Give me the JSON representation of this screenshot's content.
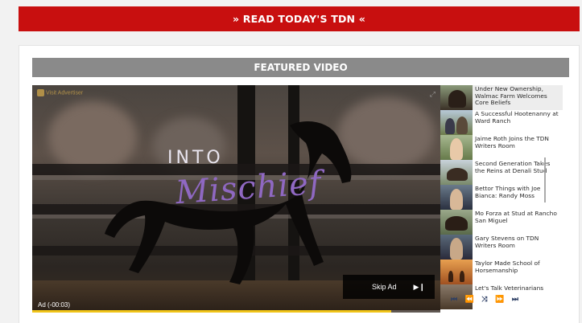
{
  "banner": {
    "label": "» READ TODAY'S TDN «"
  },
  "section": {
    "title": "FEATURED VIDEO"
  },
  "player": {
    "advertiser_link": "Visit Advertiser",
    "overlay_line1": "INTO",
    "overlay_line2": "Mischief",
    "ad_timer": "Ad (-00:03)",
    "skip_label": "Skip Ad",
    "progress": 0.88
  },
  "playlist": {
    "items": [
      {
        "title": "Under New Ownership, Walmac Farm Welcomes Core Beliefs",
        "active": true
      },
      {
        "title": "A Successful Hootenanny at Ward Ranch"
      },
      {
        "title": "Jaime Roth Joins the TDN Writers Room"
      },
      {
        "title": "Second Generation Takes the Reins at Denali Stud"
      },
      {
        "title": "Bettor Things with Joe Bianca: Randy Moss"
      },
      {
        "title": "Mo Forza at Stud at Rancho San Miguel"
      },
      {
        "title": "Gary Stevens on TDN Writers Room"
      },
      {
        "title": "Taylor Made School of Horsemanship"
      },
      {
        "title": "Let's Talk Veterinarians"
      }
    ],
    "controls": [
      "first",
      "previous",
      "shuffle",
      "next",
      "last"
    ]
  },
  "colors": {
    "banner": "#c80f0f",
    "section": "#8a8a8a",
    "controls": "#2c3e64",
    "progress": "#f0c419"
  }
}
